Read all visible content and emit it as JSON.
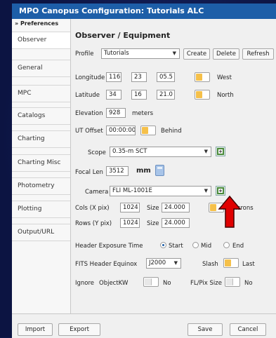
{
  "window": {
    "title": "MPO Canopus Configuration: Tutorials ALC"
  },
  "sidebar": {
    "header": "» Preferences",
    "items": [
      {
        "label": "Observer"
      },
      {
        "label": "General"
      },
      {
        "label": "MPC"
      },
      {
        "label": "Catalogs"
      },
      {
        "label": "Charting"
      },
      {
        "label": "Charting Misc"
      },
      {
        "label": "Photometry"
      },
      {
        "label": "Plotting"
      },
      {
        "label": "Output/URL"
      }
    ]
  },
  "section": {
    "title": "Observer / Equipment"
  },
  "profile": {
    "label": "Profile",
    "value": "Tutorials",
    "create": "Create",
    "delete": "Delete",
    "refresh": "Refresh"
  },
  "longitude": {
    "label": "Longitude",
    "deg": "116",
    "min": "23",
    "sec": "05.5",
    "dir": "West"
  },
  "latitude": {
    "label": "Latitude",
    "deg": "34",
    "min": "16",
    "sec": "21.0",
    "dir": "North"
  },
  "elevation": {
    "label": "Elevation",
    "value": "928",
    "unit": "meters"
  },
  "ut_offset": {
    "label": "UT Offset",
    "value": "00:00:00",
    "dir": "Behind"
  },
  "scope": {
    "label": "Scope",
    "value": "0.35-m SCT"
  },
  "focal": {
    "label": "Focal Len",
    "value": "3512",
    "unit": "mm"
  },
  "camera": {
    "label": "Camera",
    "value": "FLI ML-1001E"
  },
  "cols": {
    "label": "Cols (X pix)",
    "value": "1024",
    "size_label": "Size",
    "size": "24.000",
    "unit": "microns"
  },
  "rows": {
    "label": "Rows (Y pix)",
    "value": "1024",
    "size_label": "Size",
    "size": "24.000"
  },
  "header_exposure": {
    "label": "Header Exposure Time",
    "start": "Start",
    "mid": "Mid",
    "end": "End",
    "selected": "Start"
  },
  "fits_equinox": {
    "label": "FITS Header Equinox",
    "value": "J2000",
    "slash": "Slash",
    "last": "Last"
  },
  "ignore": {
    "label": "Ignore",
    "objectkw": "ObjectKW",
    "no1": "No",
    "flpix": "FL/Pix Size",
    "no2": "No"
  },
  "footer": {
    "import": "Import",
    "export": "Export",
    "save": "Save",
    "cancel": "Cancel"
  },
  "colors": {
    "titlebar": "#1d5ea8",
    "toggle_on": "#f5c04a",
    "annotation_arrow": "#e00000"
  }
}
